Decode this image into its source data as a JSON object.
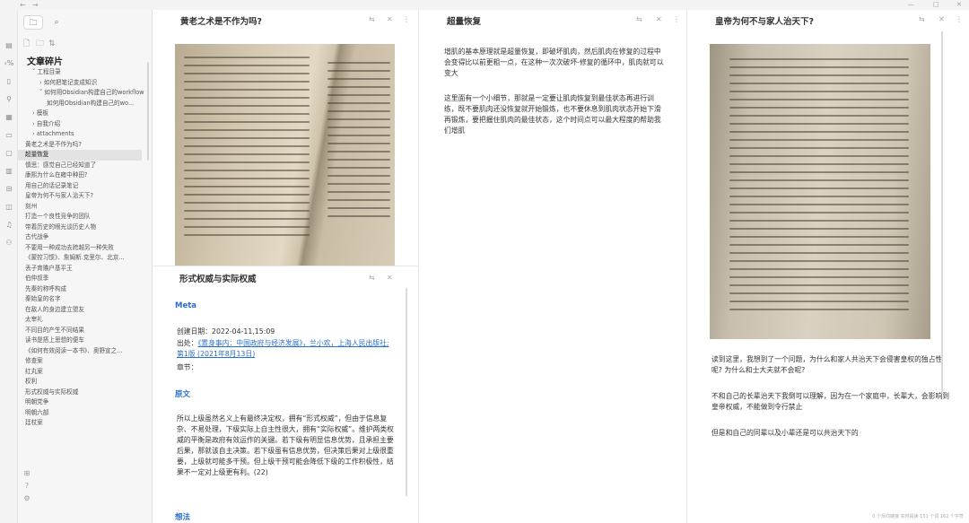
{
  "titlebar": {
    "back": "←",
    "forward": "→",
    "minimize": "—",
    "maximize": "□",
    "close": "✕"
  },
  "ribbon": {
    "icons": [
      "files-icon",
      "search-icon",
      "graph-icon",
      "calendar-icon",
      "tag-icon",
      "template-icon",
      "command-icon",
      "grid-icon",
      "map-icon",
      "stack-icon",
      "audio-icon",
      "settings-icon"
    ]
  },
  "sidebar": {
    "tab_files": "🗀",
    "tab_search": "⌕",
    "nav_new_note": "🗋",
    "nav_new_folder": "🗀",
    "nav_sort": "⇅",
    "vault_title": "文章碎片",
    "tree": [
      {
        "label": "˅ 工程目录",
        "indent": 1
      },
      {
        "label": "› 如何把笔记变成知识",
        "indent": 2
      },
      {
        "label": "˅ 如何用Obsidian构建自己的workflow",
        "indent": 2
      },
      {
        "label": "如何用Obsidian构建自己的wo...",
        "indent": 3
      },
      {
        "label": "› 模板",
        "indent": 1
      },
      {
        "label": "› 自我介绍",
        "indent": 1
      },
      {
        "label": "› attachments",
        "indent": 1
      },
      {
        "label": "黄老之术是不作为吗?",
        "indent": 0
      },
      {
        "label": "超量恢复",
        "indent": 0,
        "active": true
      },
      {
        "label": "慎思：感觉自己已经知道了",
        "indent": 0
      },
      {
        "label": "康熙为什么在雍中种田?",
        "indent": 0
      },
      {
        "label": "用自己的话记录笔记",
        "indent": 0
      },
      {
        "label": "皇帝为何不与家人治天下?",
        "indent": 0
      },
      {
        "label": "刻州",
        "indent": 0
      },
      {
        "label": "打造一个良性竞争的团队",
        "indent": 0
      },
      {
        "label": "带着历史的眼光谈历史人物",
        "indent": 0
      },
      {
        "label": "古代战争",
        "indent": 0
      },
      {
        "label": "不要用一种成功去跨越另一种失败",
        "indent": 0
      },
      {
        "label": "《蒙控习惯》、詹姆斯.克里尔、北京...",
        "indent": 0
      },
      {
        "label": "丢子育赡户基平王",
        "indent": 0
      },
      {
        "label": "伯仲叔季",
        "indent": 0
      },
      {
        "label": "先秦的称呼构成",
        "indent": 0
      },
      {
        "label": "秦始皇的名字",
        "indent": 0
      },
      {
        "label": "在敌人的身边建立盟友",
        "indent": 0
      },
      {
        "label": "太宰礼",
        "indent": 0
      },
      {
        "label": "不同目的产生不同结果",
        "indent": 0
      },
      {
        "label": "读书是搭上思想的便车",
        "indent": 0
      },
      {
        "label": "《如何有效阅读一本书》、奥野宣之...",
        "indent": 0
      },
      {
        "label": "修查案",
        "indent": 0
      },
      {
        "label": "红丸案",
        "indent": 0
      },
      {
        "label": "权利",
        "indent": 0
      },
      {
        "label": "形式权威与实际权威",
        "indent": 0
      },
      {
        "label": "明朝党争",
        "indent": 0
      },
      {
        "label": "明朝六部",
        "indent": 0
      },
      {
        "label": "廷杖案",
        "indent": 0
      }
    ],
    "foot_icons": [
      "vault-icon",
      "help-icon",
      "settings-icon"
    ],
    "foot_glyphs": [
      "⊞",
      "?",
      "⚙"
    ]
  },
  "pane1": {
    "title": "黄老之术是不作为吗?",
    "ctl_link": "⇆",
    "ctl_close": "✕",
    "ctl_more": "⋮"
  },
  "pane2": {
    "title": "形式权威与实际权威",
    "ctl_link": "⇆",
    "ctl_close": "✕",
    "meta_heading": "Meta",
    "created": "创建日期：2022-04-11,15:09",
    "source_label": "出处：",
    "source_link": "《置身事内：中国政府与经济发展》，兰小欢，上海人民出版社; 第1版 (2021年8月13日)",
    "chapter": "章节：",
    "original_heading": "原文",
    "original_text": "所以上级虽然名义上有最终决定权，拥有“形式权威”，但由于信息复杂、不易处理，下级实际上自主性很大，拥有“实际权威”。维护两类权威的平衡是政府有效运作的关键。若下级有明显信息优势，且承担主要后果，那就该自主决策。若下级虽有信息优势，但决策后果对上级很重要，上级就可能多干预。但上级干预可能会降低下级的工作积极性，结果不一定对上级更有利。(22)",
    "thoughts_heading": "想法"
  },
  "pane3": {
    "title": "超量恢复",
    "ctl_link": "⇆",
    "ctl_close": "✕",
    "ctl_more": "⋮",
    "para1": "增肌的基本原理就是超量恢复，即破坏肌肉，然后肌肉在修复的过程中会变得比以前更粗一点，在这种一次次破坏-修复的循环中，肌肉就可以变大",
    "para2": "这里面有一个小细节，那就是一定要让肌肉恢复到最佳状态再进行训练，既不要肌肉还没恢复就开始锻炼，也不要休息到肌肉状态开始下滑再锻炼，要把握住肌肉的最佳状态，这个时间点可以最大程度的帮助我们增肌"
  },
  "pane4": {
    "title": "皇帝为何不与家人治天下?",
    "ctl_link": "⇆",
    "ctl_close": "✕",
    "ctl_more": "⋮",
    "para1": "读到这里，我想到了一个问题，为什么和家人共治天下会侵害皇权的独占性呢? 为什么和士大夫就不会呢?",
    "para2": "不和自己的长辈治天下我倒可以理解，因为在一个家庭中，长辈大，会影响到皇帝权威，不能做到令行禁止",
    "para3": "但是和自己的同辈以及小辈还是可以共治天下的"
  },
  "status": {
    "text": "0 个反向链接   实时阅读   151 个词   162 个字符"
  },
  "colors": {
    "accent": "#2a6fc9",
    "active_item": "#e3e3e3",
    "sidebar_bg": "#f6f6f6"
  }
}
